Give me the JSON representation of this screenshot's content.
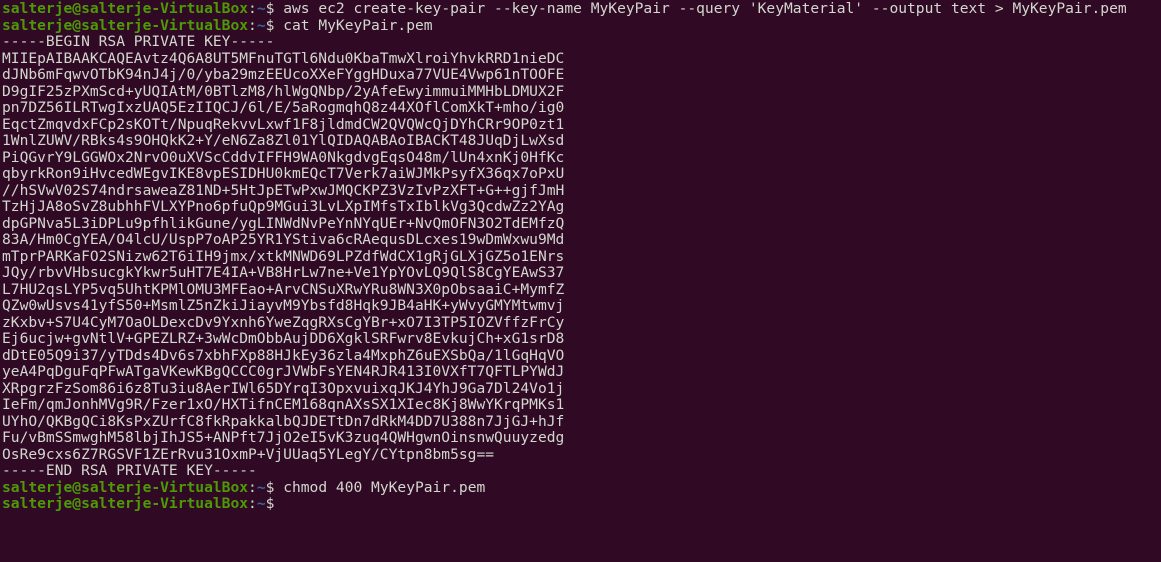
{
  "terminal": {
    "background_color": "#300a24",
    "foreground_color": "#d3d7cf",
    "prompt_user_color": "#4e9a06",
    "prompt_path_color": "#3465a4",
    "prompt": {
      "user_host": "salterje@salterje-VirtualBox",
      "colon": ":",
      "path": "~",
      "dollar": "$"
    },
    "lines": [
      {
        "type": "prompt",
        "command": " aws ec2 create-key-pair --key-name MyKeyPair --query 'KeyMaterial' --output text > MyKeyPair.pem"
      },
      {
        "type": "prompt",
        "command": " cat MyKeyPair.pem"
      },
      {
        "type": "output",
        "text": "-----BEGIN RSA PRIVATE KEY-----"
      },
      {
        "type": "output",
        "text": "MIIEpAIBAAKCAQEAvtz4Q6A8UT5MFnuTGTl6Ndu0KbaTmwXlroiYhvkRRD1nieDC"
      },
      {
        "type": "output",
        "text": "dJNb6mFqwvOTbK94nJ4j/0/yba29mzEEUcoXXeFYggHDuxa77VUE4Vwp61nTOOFE"
      },
      {
        "type": "output",
        "text": "D9gIF25zPXmScd+yUQIAtM/0BTlzM8/hlWgQNbp/2yAfeEwyimmuiMMHbLDMUX2F"
      },
      {
        "type": "output",
        "text": "pn7DZ56ILRTwgIxzUAQ5EzIIQCJ/6l/E/5aRogmqhQ8z44XOflComXkT+mho/ig0"
      },
      {
        "type": "output",
        "text": "EqctZmqvdxFCp2sKOTt/NpuqRekvvLxwf1F8jldmdCW2QVQWcQjDYhCRr9OP0zt1"
      },
      {
        "type": "output",
        "text": "1WnlZUWV/RBks4s9OHQkK2+Y/eN6Za8Zl01YlQIDAQABAoIBACKT48JUqDjLwXsd"
      },
      {
        "type": "output",
        "text": "PiQGvrY9LGGWOx2NrvO0uXVScCddvIFFH9WA0NkgdvgEqsO48m/lUn4xnKj0HfKc"
      },
      {
        "type": "output",
        "text": "qbyrkRon9iHvcedWEgvIKE8vpESIDHU0kmEQcT7Verk7aiWJMkPsyfX36qx7oPxU"
      },
      {
        "type": "output",
        "text": "//hSVwV02S74ndrsaweaZ81ND+5HtJpETwPxwJMQCKPZ3VzIvPzXFT+G++gjfJmH"
      },
      {
        "type": "output",
        "text": "TzHjJA8oSvZ8ubhhFVLXYPno6pfuQp9MGui3LvLXpIMfsTxIblkVg3QcdwZz2YAg"
      },
      {
        "type": "output",
        "text": "dpGPNva5L3iDPLu9pfhlikGune/ygLINWdNvPeYnNYqUEr+NvQmOFN3O2TdEMfzQ"
      },
      {
        "type": "output",
        "text": "83A/Hm0CgYEA/O4lcU/UspP7oAP25YR1YStiva6cRAequsDLcxes19wDmWxwu9Md"
      },
      {
        "type": "output",
        "text": "mTprPARKaFO2SNizw62T6iIH9jmx/xtkMNWD69LPZdfWdCX1gRjGLXjGZ5o1ENrs"
      },
      {
        "type": "output",
        "text": "JQy/rbvVHbsucgkYkwr5uHT7E4IA+VB8HrLw7ne+Ve1YpYOvLQ9QlS8CgYEAwS37"
      },
      {
        "type": "output",
        "text": "L7HU2qsLYP5vq5UhtKPMlOMU3MFEao+ArvCNSuXRwYRu8WN3X0pObsaaiC+MymfZ"
      },
      {
        "type": "output",
        "text": "QZw0wUsvs41yfS50+MsmlZ5nZkiJiayvM9Ybsfd8Hqk9JB4aHK+yWvyGMYMtwmvj"
      },
      {
        "type": "output",
        "text": "zKxbv+S7U4CyM7OaOLDexcDv9Yxnh6YweZqgRXsCgYBr+xO7I3TP5IOZVffzFrCy"
      },
      {
        "type": "output",
        "text": "Ej6ucjw+gvNtlV+GPEZLRZ+3wWcDmObbAujDD6XgklSRFwrv8EvkujCh+xG1srD8"
      },
      {
        "type": "output",
        "text": "dDtE05Q9i37/yTDds4Dv6s7xbhFXp88HJkEy36zla4MxphZ6uEXSbQa/1lGqHqVO"
      },
      {
        "type": "output",
        "text": "yeA4PqDguFqPFwATgaVKewKBgQCCC0grJVWbFsYEN4RJR413I0VXfT7QFTLPYWdJ"
      },
      {
        "type": "output",
        "text": "XRpgrzFzSom86i6z8Tu3iu8AerIWl65DYrqI3OpxvuixqJKJ4YhJ9Ga7Dl24Vo1j"
      },
      {
        "type": "output",
        "text": "IeFm/qmJonhMVg9R/Fzer1xO/HXTifnCEM168qnAXsSX1XIec8Kj8WwYKrqPMKs1"
      },
      {
        "type": "output",
        "text": "UYhO/QKBgQCi8KsPxZUrfC8fkRpakkalbQJDETtDn7dRkM4DD7U388n7JjGJ+hJf"
      },
      {
        "type": "output",
        "text": "Fu/vBmSSmwghM58lbjIhJS5+ANPft7JjO2eI5vK3zuq4QWHgwnOinsnwQuuyzedg"
      },
      {
        "type": "output",
        "text": "OsRe9cxs6Z7RGSVF1ZErRvu31OxmP+VjUUaq5YLegY/CYtpn8bm5sg=="
      },
      {
        "type": "output",
        "text": "-----END RSA PRIVATE KEY-----"
      },
      {
        "type": "prompt",
        "command": " chmod 400 MyKeyPair.pem"
      },
      {
        "type": "prompt",
        "command": ""
      }
    ]
  }
}
